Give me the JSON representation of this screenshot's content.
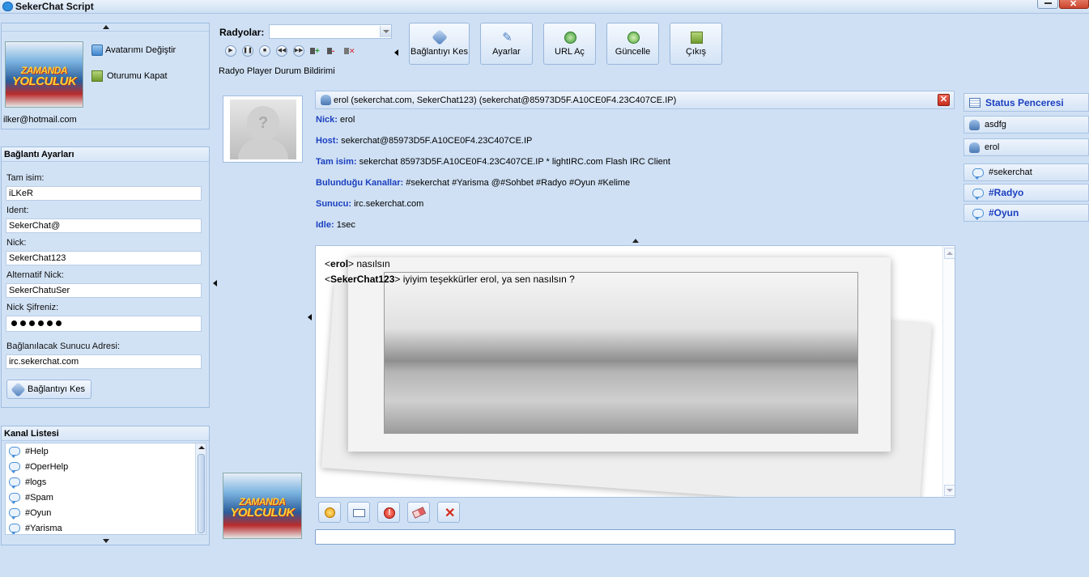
{
  "window": {
    "title": "SekerChat Script"
  },
  "profile": {
    "change_avatar": "Avatarımı Değiştir",
    "logout": "Oturumu Kapat",
    "email": "ilker@hotmail.com",
    "poster_title_1": "ZAMANDA",
    "poster_title_2": "YOLCULUK"
  },
  "connection": {
    "header": "Bağlantı Ayarları",
    "fullname_label": "Tam isim:",
    "fullname_value": "iLKeR",
    "ident_label": "Ident:",
    "ident_value": "SekerChat@",
    "nick_label": "Nick:",
    "nick_value": "SekerChat123",
    "altnick_label": "Alternatif Nick:",
    "altnick_value": "SekerChatuSer",
    "password_label": "Nick Şifreniz:",
    "server_label": "Bağlanılacak Sunucu Adresi:",
    "server_value": "irc.sekerchat.com",
    "disconnect_label": "Bağlantıyı Kes"
  },
  "channel_list": {
    "header": "Kanal Listesi",
    "items": [
      "#Help",
      "#OperHelp",
      "#logs",
      "#Spam",
      "#Oyun",
      "#Yarisma"
    ]
  },
  "toolbar": {
    "radio_label": "Radyolar:",
    "radio_status": "Radyo Player Durum Bildirimi",
    "buttons": [
      "Bağlantıyı Kes",
      "Ayarlar",
      "URL Aç",
      "Güncelle",
      "Çıkış"
    ],
    "colors": {
      "accent": "#1a3fbf",
      "panel": "#d2e2f5",
      "background": "#cfe0f4"
    }
  },
  "whois": {
    "header": "erol (sekerchat.com, SekerChat123) (sekerchat@85973D5F.A10CE0F4.23C407CE.IP)",
    "nick_key": "Nick:",
    "nick_val": "erol",
    "host_key": "Host:",
    "host_val": "sekerchat@85973D5F.A10CE0F4.23C407CE.IP",
    "name_key": "Tam isim:",
    "name_val": "sekerchat 85973D5F.A10CE0F4.23C407CE.IP * lightIRC.com Flash IRC Client",
    "channels_key": "Bulunduğu Kanallar:",
    "channels_val": "#sekerchat #Yarisma @#Sohbet #Radyo #Oyun #Kelime",
    "server_key": "Sunucu:",
    "server_val": "irc.sekerchat.com",
    "idle_key": "Idle:",
    "idle_val": "1sec"
  },
  "messages": [
    {
      "nick": "erol",
      "text": "nasılsın"
    },
    {
      "nick": "SekerChat123",
      "text": "iyiyim teşekkürler erol, ya sen nasılsın ?"
    }
  ],
  "right_panel": {
    "status": "Status Penceresi",
    "users": [
      "asdfg",
      "erol"
    ],
    "channels": [
      {
        "name": "#sekerchat",
        "bold": false
      },
      {
        "name": "#Radyo",
        "bold": true
      },
      {
        "name": "#Oyun",
        "bold": true
      }
    ]
  }
}
